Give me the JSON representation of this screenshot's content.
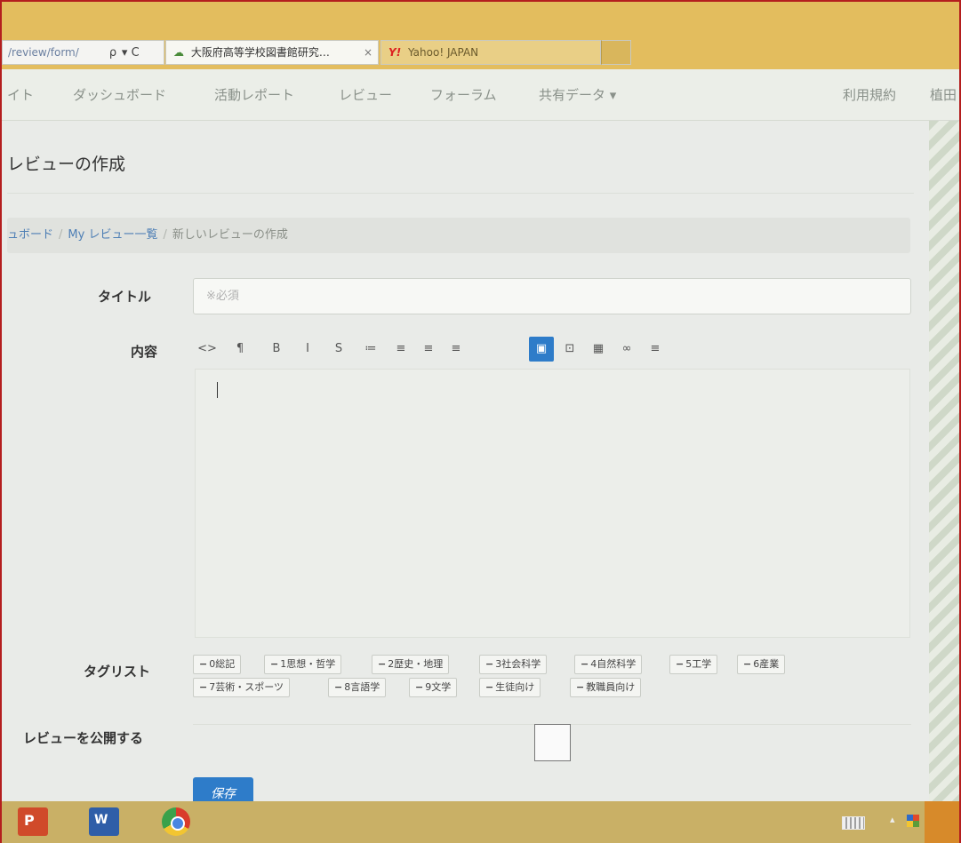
{
  "browser": {
    "url": "/review/form/",
    "search_glyph": "ρ",
    "refresh_glyph": "▾ C",
    "tabs": [
      {
        "label": "大阪府高等学校図書館研究…",
        "close": "×"
      },
      {
        "label": "Yahoo! JAPAN"
      }
    ]
  },
  "nav": {
    "items": [
      "イト",
      "ダッシュボード",
      "活動レポート",
      "レビュー",
      "フォーラム",
      "共有データ ▾"
    ],
    "right_items": [
      "利用規約",
      "植田"
    ]
  },
  "page": {
    "title": "レビューの作成"
  },
  "breadcrumb": {
    "items": [
      "ュボード",
      "My レビュー一覧"
    ],
    "current": "新しいレビューの作成",
    "separator": "/"
  },
  "form": {
    "title_label": "タイトル",
    "title_placeholder": "※必須",
    "content_label": "内容",
    "toolbar": [
      "<>",
      "¶",
      "B",
      "I",
      "S",
      "≔",
      "≡",
      "≡",
      "≡",
      "▣",
      "⊡",
      "▦",
      "∞",
      "≡"
    ],
    "toolbar_active_index": 9,
    "tags_label": "タグリスト",
    "tags": [
      "0総記",
      "1思想・哲学",
      "2歴史・地理",
      "3社会科学",
      "4自然科学",
      "5工学",
      "6産業",
      "7芸術・スポーツ",
      "8言語学",
      "9文学",
      "生徒向け",
      "教職員向け"
    ],
    "tag_prefix": "−",
    "publish_label": "レビューを公開する",
    "save_label": "保存"
  },
  "colors": {
    "accent": "#2e7cc9",
    "link": "#4e7fb5",
    "browser_chrome": "#e3bd5e",
    "taskbar": "#c9b066"
  }
}
